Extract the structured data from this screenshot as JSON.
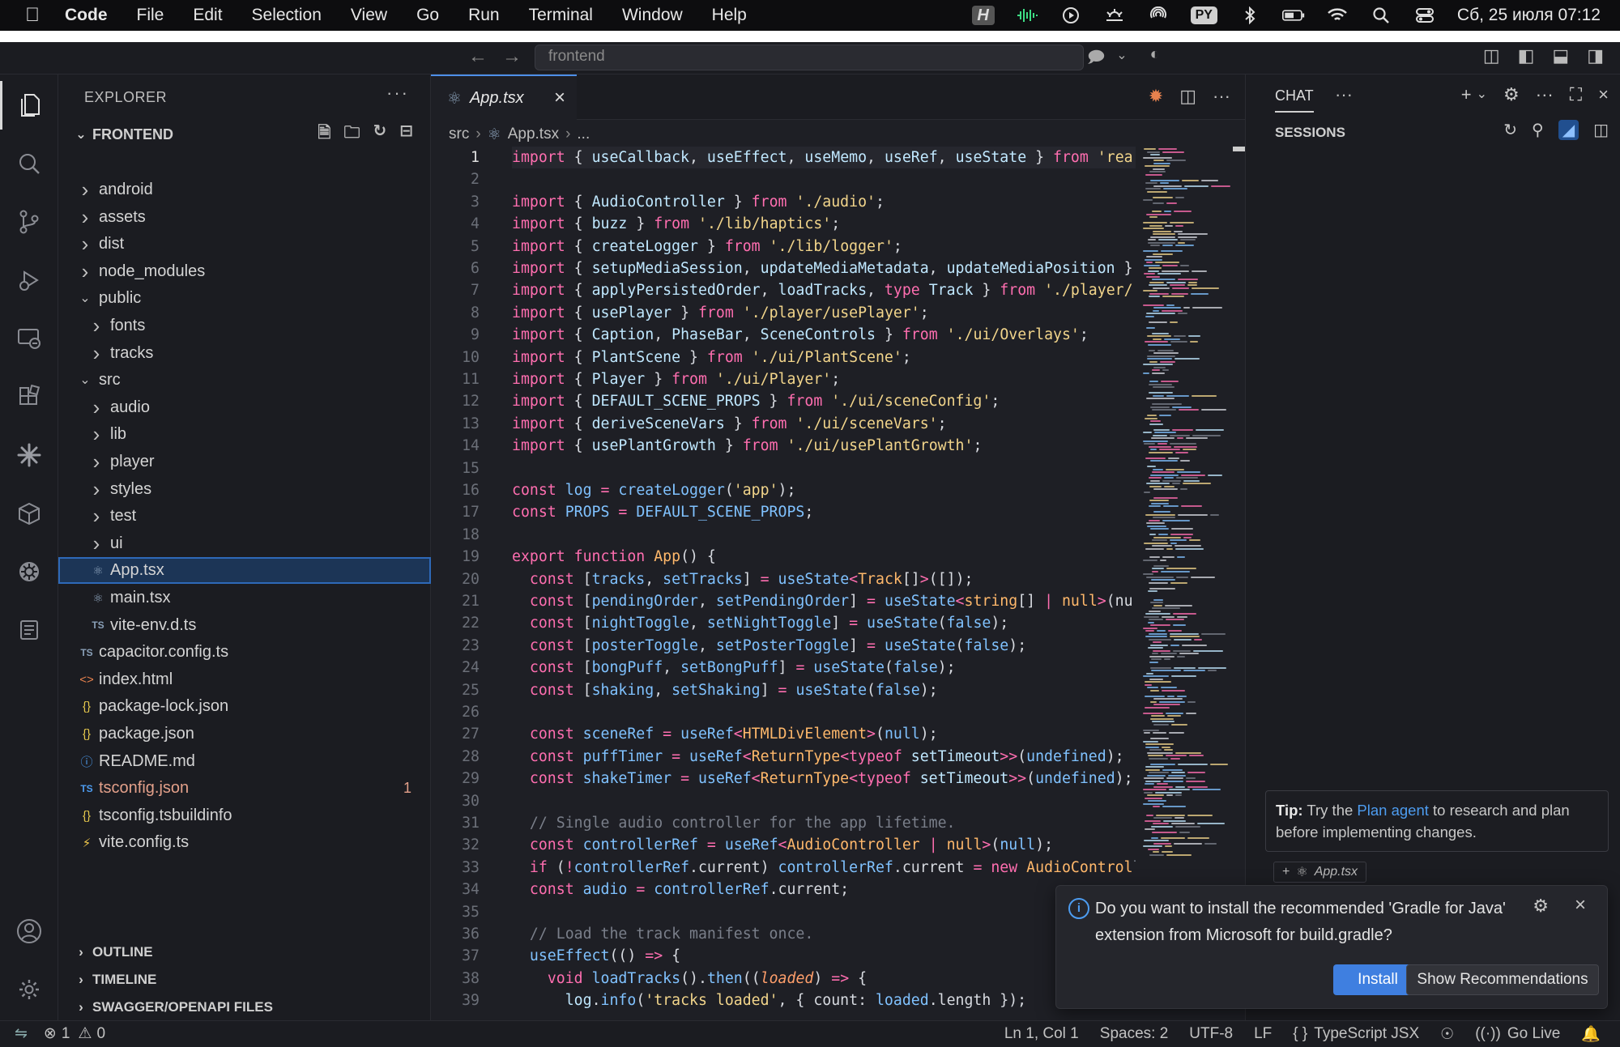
{
  "menubar": {
    "app": "Code",
    "items": [
      "File",
      "Edit",
      "Selection",
      "View",
      "Go",
      "Run",
      "Terminal",
      "Window",
      "Help"
    ],
    "py_badge": "PY",
    "clock": "Сб, 25 июля  07:12"
  },
  "titlebar": {
    "search_text": "frontend"
  },
  "explorer": {
    "title": "EXPLORER",
    "root": "FRONTEND",
    "tree": [
      {
        "label": "android",
        "depth": 0,
        "kind": "folder",
        "open": false
      },
      {
        "label": "assets",
        "depth": 0,
        "kind": "folder",
        "open": false
      },
      {
        "label": "dist",
        "depth": 0,
        "kind": "folder",
        "open": false
      },
      {
        "label": "node_modules",
        "depth": 0,
        "kind": "folder",
        "open": false
      },
      {
        "label": "public",
        "depth": 0,
        "kind": "folder",
        "open": true
      },
      {
        "label": "fonts",
        "depth": 1,
        "kind": "folder",
        "open": false
      },
      {
        "label": "tracks",
        "depth": 1,
        "kind": "folder",
        "open": false
      },
      {
        "label": "src",
        "depth": 0,
        "kind": "folder",
        "open": true
      },
      {
        "label": "audio",
        "depth": 1,
        "kind": "folder",
        "open": false
      },
      {
        "label": "lib",
        "depth": 1,
        "kind": "folder",
        "open": false
      },
      {
        "label": "player",
        "depth": 1,
        "kind": "folder",
        "open": false
      },
      {
        "label": "styles",
        "depth": 1,
        "kind": "folder",
        "open": false
      },
      {
        "label": "test",
        "depth": 1,
        "kind": "folder",
        "open": false
      },
      {
        "label": "ui",
        "depth": 1,
        "kind": "folder",
        "open": false
      },
      {
        "label": "App.tsx",
        "depth": 1,
        "kind": "react",
        "selected": true
      },
      {
        "label": "main.tsx",
        "depth": 1,
        "kind": "react"
      },
      {
        "label": "vite-env.d.ts",
        "depth": 1,
        "kind": "ts"
      },
      {
        "label": "capacitor.config.ts",
        "depth": 0,
        "kind": "ts"
      },
      {
        "label": "index.html",
        "depth": 0,
        "kind": "html"
      },
      {
        "label": "package-lock.json",
        "depth": 0,
        "kind": "json"
      },
      {
        "label": "package.json",
        "depth": 0,
        "kind": "json"
      },
      {
        "label": "README.md",
        "depth": 0,
        "kind": "info"
      },
      {
        "label": "tsconfig.json",
        "depth": 0,
        "kind": "tsconfig",
        "badge": "1",
        "warn": true
      },
      {
        "label": "tsconfig.tsbuildinfo",
        "depth": 0,
        "kind": "json"
      },
      {
        "label": "vite.config.ts",
        "depth": 0,
        "kind": "vite"
      }
    ],
    "sections": [
      "OUTLINE",
      "TIMELINE",
      "SWAGGER/OPENAPI FILES"
    ]
  },
  "editor": {
    "tab_label": "App.tsx",
    "breadcrumb": [
      "src",
      "App.tsx",
      "..."
    ],
    "current_line": 1
  },
  "chat": {
    "title": "CHAT",
    "sessions": "SESSIONS",
    "tip_bold": "Tip:",
    "tip_pre": " Try the ",
    "tip_link": "Plan agent",
    "tip_post": " to research and plan before implementing changes.",
    "context_file": "App.tsx"
  },
  "notification": {
    "message": "Do you want to install the recommended 'Gradle for Java' extension from Microsoft for build.gradle?",
    "install_label": "Install",
    "show_label": "Show Recommendations"
  },
  "statusbar": {
    "errors": "1",
    "warnings": "0",
    "position": "Ln 1, Col 1",
    "spaces": "Spaces: 2",
    "encoding": "UTF-8",
    "eol": "LF",
    "language": "TypeScript JSX",
    "golive": "Go Live"
  },
  "colors": {
    "accent": "#3f7fe0",
    "selection_bg": "#1c3556",
    "keyword": "#ff6eb0",
    "string": "#f2d58b",
    "function": "#80c2ff"
  }
}
